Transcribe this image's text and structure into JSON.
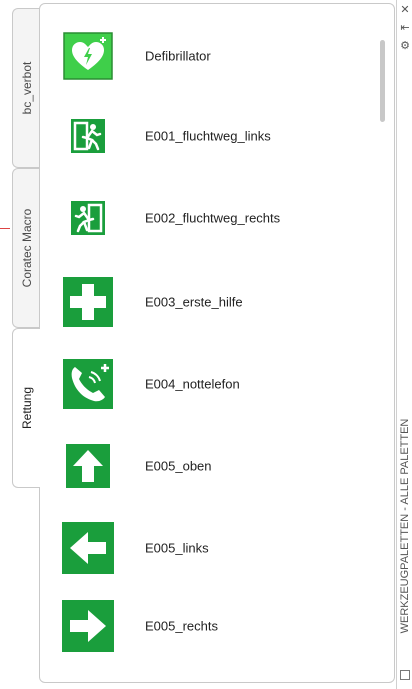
{
  "tabs": [
    {
      "label": "bc_verbot"
    },
    {
      "label": "Coratec Macro"
    },
    {
      "label": "Rettung"
    }
  ],
  "items": [
    {
      "label": "Defibrillator",
      "icon": "defibrillator-icon"
    },
    {
      "label": "E001_fluchtweg_links",
      "icon": "exit-running-man-left-icon"
    },
    {
      "label": "E002_fluchtweg_rechts",
      "icon": "exit-running-man-right-icon"
    },
    {
      "label": "E003_erste_hilfe",
      "icon": "first-aid-cross-icon"
    },
    {
      "label": "E004_nottelefon",
      "icon": "emergency-phone-icon"
    },
    {
      "label": "E005_oben",
      "icon": "arrow-up-icon"
    },
    {
      "label": "E005_links",
      "icon": "arrow-left-icon"
    },
    {
      "label": "E005_rechts",
      "icon": "arrow-right-icon"
    }
  ],
  "strip": {
    "title": "WERKZEUGPALETTEN - ALLE PALETTEN",
    "close_glyph": "✕",
    "autohide_glyph": "⇤",
    "properties_glyph": "⚙"
  },
  "colors": {
    "safety_green": "#1a9e3c",
    "defib_green": "#3fcf4a"
  }
}
